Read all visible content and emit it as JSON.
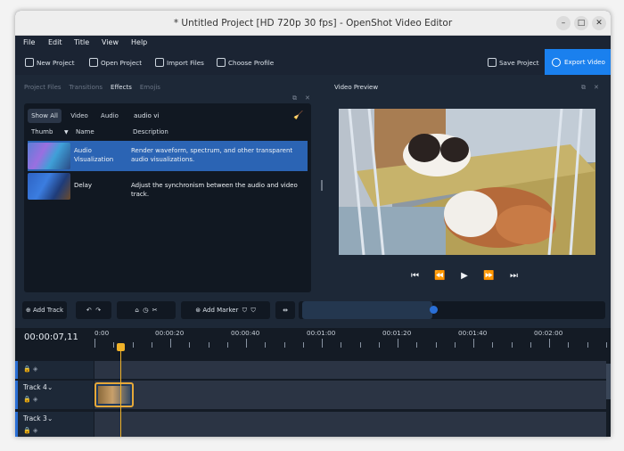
{
  "window": {
    "title": "* Untitled Project [HD 720p 30 fps] - OpenShot Video Editor"
  },
  "menu": [
    "File",
    "Edit",
    "Title",
    "View",
    "Help"
  ],
  "toolbar": {
    "new_project": "New Project",
    "open_project": "Open Project",
    "import_files": "Import Files",
    "choose_profile": "Choose Profile",
    "save_project": "Save Project",
    "export_video": "Export Video"
  },
  "left_tabs": [
    "Project Files",
    "Transitions",
    "Effects",
    "Emojis"
  ],
  "effects": {
    "filters": [
      "Show All",
      "Video",
      "Audio"
    ],
    "search_value": "audio vi",
    "columns": [
      "Thumb",
      "Name",
      "Description"
    ],
    "rows": [
      {
        "name": "Audio Visualization",
        "description": "Render waveform, spectrum, and other transparent audio visualizations."
      },
      {
        "name": "Delay",
        "description": "Adjust the synchronism between the audio and video track."
      }
    ]
  },
  "preview": {
    "title": "Video Preview"
  },
  "timeline_toolbar": {
    "add_track": "Add Track",
    "add_marker": "Add Marker"
  },
  "timeline": {
    "timecode": "00:00:07,11",
    "ruler_labels": [
      "0:00",
      "00:00:20",
      "00:00:40",
      "00:01:00",
      "00:01:20",
      "00:01:40",
      "00:02:00"
    ],
    "tracks": [
      {
        "name": ""
      },
      {
        "name": "Track 4"
      },
      {
        "name": "Track 3"
      }
    ]
  },
  "colors": {
    "accent": "#1a80ee",
    "selection": "#2b64b4",
    "playhead": "#f0b229"
  },
  "icons": [
    "new-project-icon",
    "open-project-icon",
    "import-icon",
    "profile-icon",
    "save-icon",
    "export-icon",
    "broom-icon",
    "lock-icon",
    "play-icon"
  ]
}
